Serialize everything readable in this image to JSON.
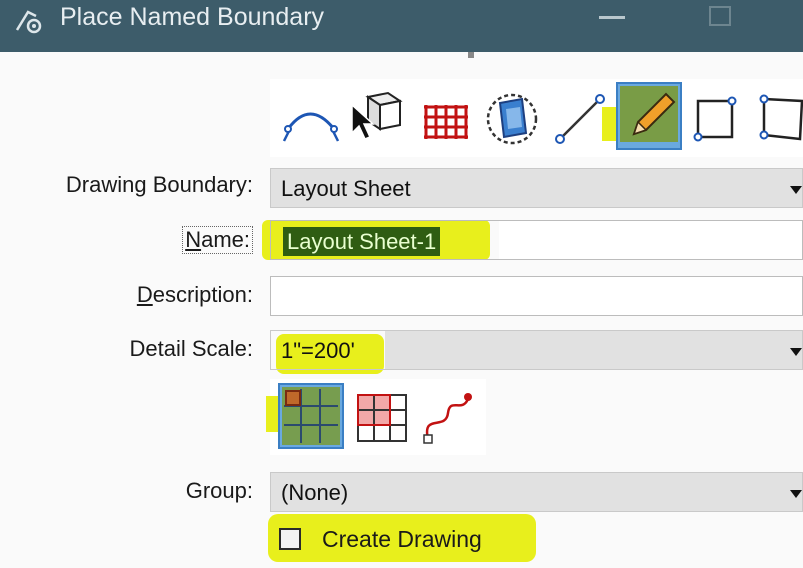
{
  "window": {
    "title": "Place Named Boundary",
    "icon": "place-boundary-icon"
  },
  "toolbar": {
    "methods": [
      {
        "name": "from-route-icon",
        "selected": false
      },
      {
        "name": "from-element-icon",
        "selected": false
      },
      {
        "name": "from-grid-icon",
        "selected": false
      },
      {
        "name": "from-view-icon",
        "selected": false
      },
      {
        "name": "from-line-icon",
        "selected": false
      },
      {
        "name": "pencil-icon",
        "selected": true
      },
      {
        "name": "rectangle-icon",
        "selected": false
      },
      {
        "name": "shape-icon",
        "selected": false
      }
    ]
  },
  "form": {
    "drawing_boundary": {
      "label": "Drawing Boundary:",
      "value": "Layout Sheet"
    },
    "name": {
      "label_u": "N",
      "label_rest": "ame:",
      "value": "Layout Sheet-1"
    },
    "description": {
      "label_u": "D",
      "label_rest": "escription:",
      "value": ""
    },
    "detail_scale": {
      "label": "Detail Scale:",
      "value": "1\"=200'"
    },
    "group": {
      "label": "Group:",
      "value": "(None)"
    },
    "create_drawing": {
      "label": "Create Drawing",
      "checked": false
    }
  },
  "scale_modes": [
    {
      "name": "grid-fill-mode-icon",
      "selected": true
    },
    {
      "name": "grid-pick-mode-icon",
      "selected": false
    },
    {
      "name": "curve-mode-icon",
      "selected": false
    }
  ],
  "colors": {
    "titlebar": "#3d5c6a",
    "highlight": "#e8ef1c",
    "selection": "#2f5d12",
    "selected_tool": "#6aa9e0"
  }
}
